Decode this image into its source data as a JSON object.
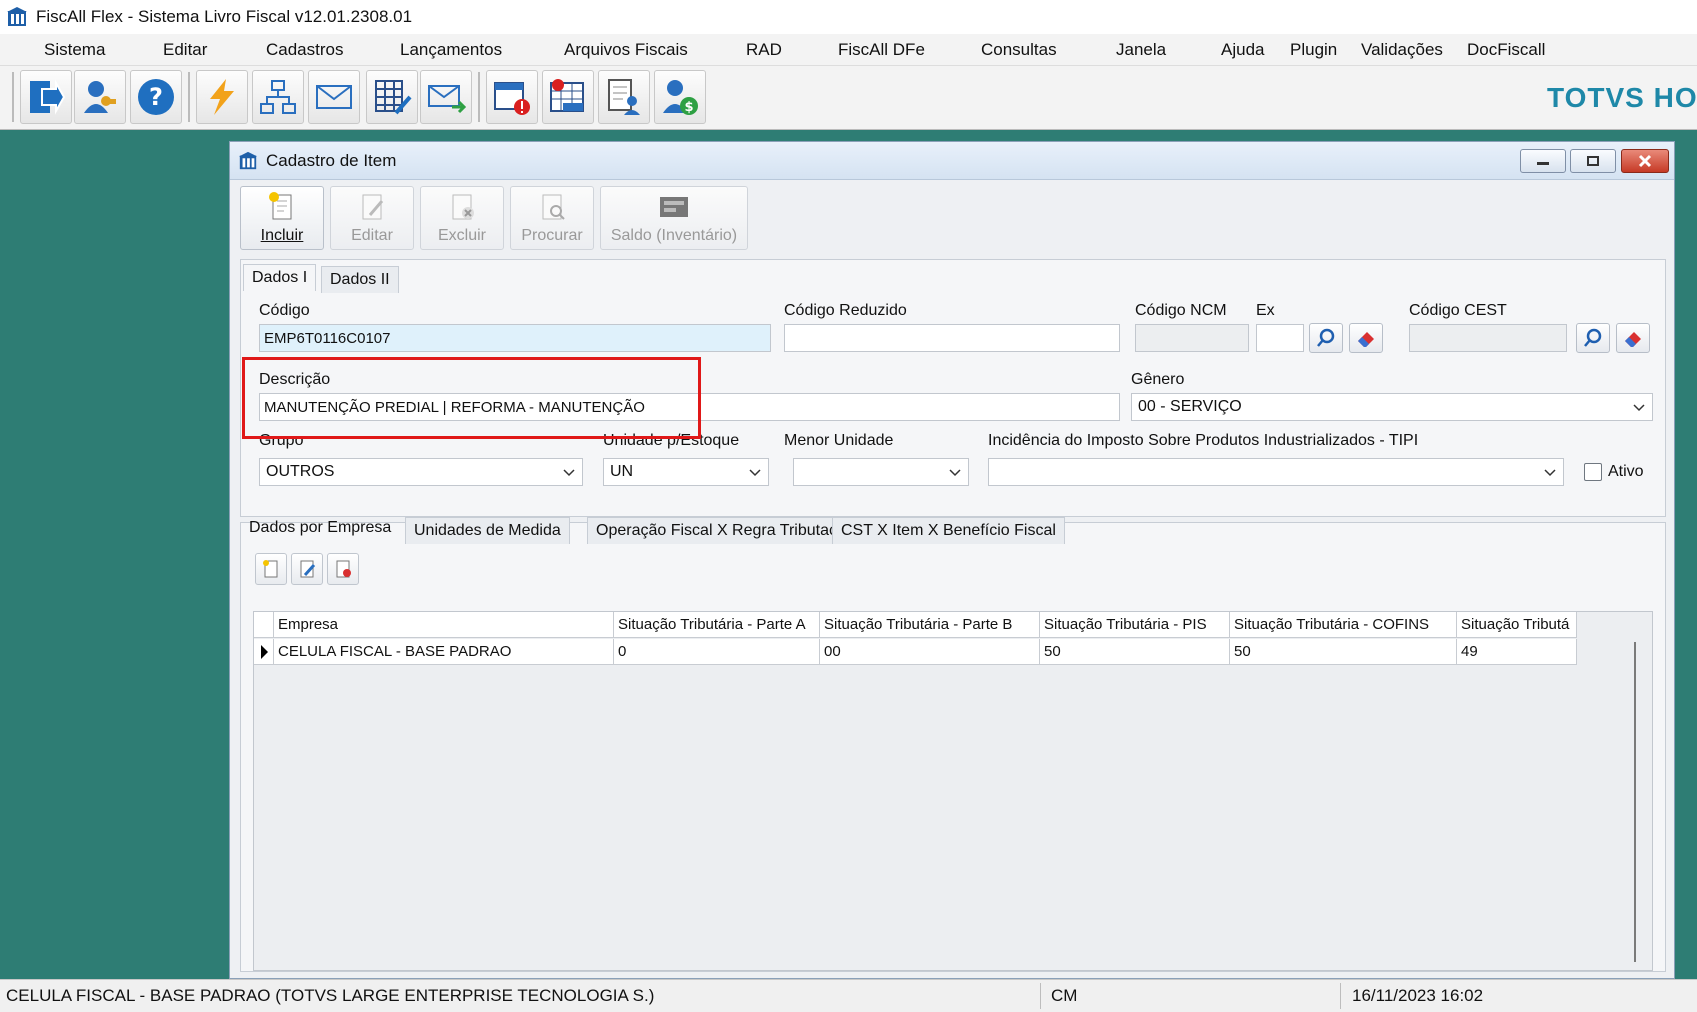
{
  "app": {
    "title": "FiscAll Flex - Sistema Livro Fiscal v12.01.2308.01",
    "brand": "TOTVS HOTÉ"
  },
  "menu": [
    "Sistema",
    "Editar",
    "Cadastros",
    "Lançamentos",
    "Arquivos Fiscais",
    "RAD",
    "FiscAll DFe",
    "Consultas",
    "Janela",
    "Ajuda",
    "Plugin",
    "Validações",
    "DocFiscall"
  ],
  "toolbar_icons": [
    "exit-icon",
    "user-key-icon",
    "help-icon",
    "lightning-icon",
    "network-icon",
    "mail-icon",
    "spreadsheet-edit-icon",
    "mail-forward-icon",
    "calendar-alert-icon",
    "icms-icon",
    "document-user-icon",
    "user-money-icon"
  ],
  "window": {
    "title": "Cadastro de Item",
    "actions": {
      "incluir": "Incluir",
      "editar": "Editar",
      "excluir": "Excluir",
      "procurar": "Procurar",
      "saldo": "Saldo (Inventário)"
    },
    "tabs": {
      "dados1": "Dados I",
      "dados2": "Dados II"
    },
    "fields": {
      "codigo": {
        "label": "Código",
        "value": "EMP6T0116C0107"
      },
      "codigo_reduzido": {
        "label": "Código Reduzido",
        "value": ""
      },
      "codigo_ncm": {
        "label": "Código NCM",
        "value": ""
      },
      "ex": {
        "label": "Ex",
        "value": ""
      },
      "codigo_cest": {
        "label": "Código CEST",
        "value": ""
      },
      "descricao": {
        "label": "Descrição",
        "value": "MANUTENÇÃO PREDIAL | REFORMA - MANUTENÇÃO"
      },
      "genero": {
        "label": "Gênero",
        "value": "00 - SERVIÇO"
      },
      "grupo": {
        "label": "Grupo",
        "value": "OUTROS"
      },
      "unidade_estoque": {
        "label": "Unidade p/Estoque",
        "value": "UN"
      },
      "menor_unidade": {
        "label": "Menor Unidade",
        "value": ""
      },
      "tipi": {
        "label": "Incidência do Imposto Sobre Produtos Industrializados - TIPI",
        "value": ""
      },
      "ativo": {
        "label": "Ativo",
        "checked": false
      }
    },
    "subtabs": {
      "empresa": "Dados por Empresa",
      "unidades": "Unidades de Medida",
      "operacao": "Operação Fiscal X Regra Tributação",
      "cst": "CST X Item X Benefício Fiscal"
    },
    "grid": {
      "columns": [
        "Empresa",
        "Situação Tributária - Parte A",
        "Situação Tributária - Parte B",
        "Situação Tributária - PIS",
        "Situação Tributária - COFINS",
        "Situação Tributá"
      ],
      "rows": [
        [
          "CELULA FISCAL - BASE PADRAO",
          "0",
          "00",
          "50",
          "50",
          "49"
        ]
      ]
    }
  },
  "status": {
    "company": "CELULA FISCAL - BASE PADRAO (TOTVS LARGE ENTERPRISE TECNOLOGIA S.)",
    "mode": "CM",
    "datetime": "16/11/2023 16:02"
  },
  "colors": {
    "desktop": "#2e7d74",
    "brand": "#1e88a8",
    "highlight": "#e01818"
  }
}
